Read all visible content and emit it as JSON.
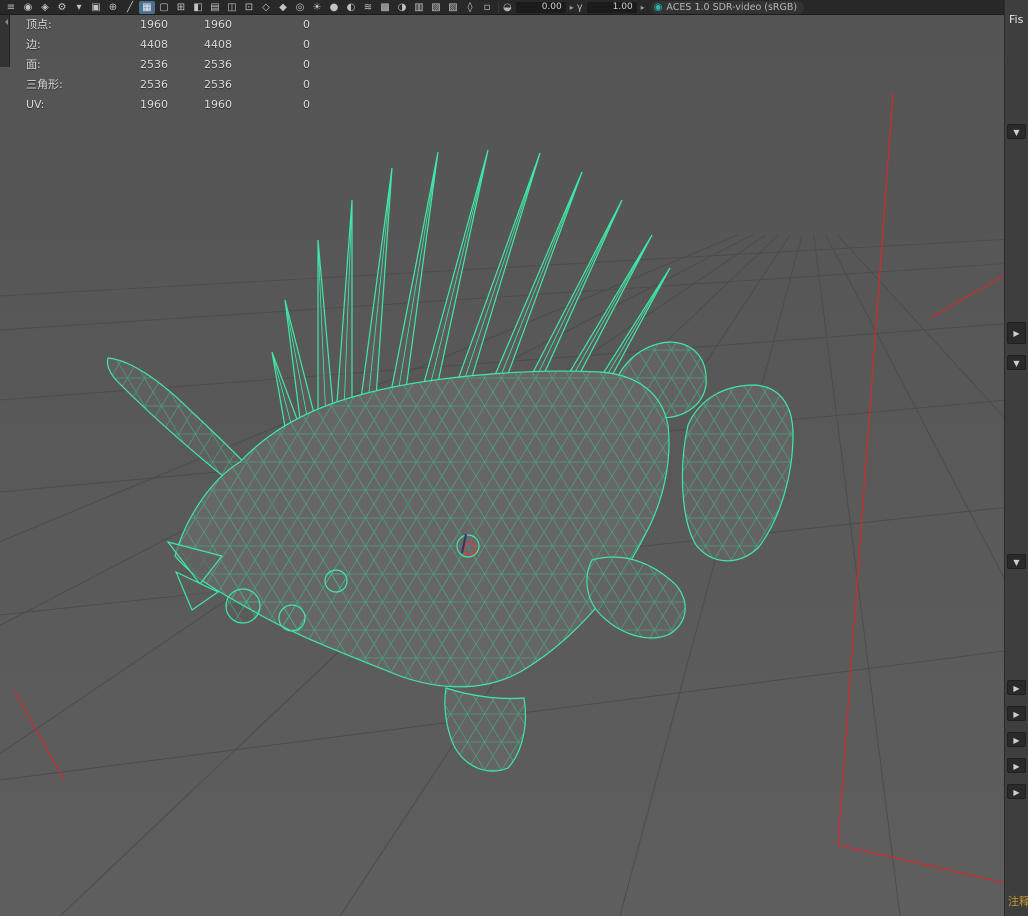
{
  "toolbar": {
    "icons": [
      {
        "name": "menu-icon",
        "glyph": "≡"
      },
      {
        "name": "select-camera-icon",
        "glyph": "◉"
      },
      {
        "name": "lock-camera-icon",
        "glyph": "◈"
      },
      {
        "name": "camera-attributes-icon",
        "glyph": "⚙"
      },
      {
        "name": "bookmarks-icon",
        "glyph": "▾"
      },
      {
        "name": "image-plane-icon",
        "glyph": "▣"
      },
      {
        "name": "pan-zoom-icon",
        "glyph": "⊕"
      },
      {
        "name": "grease-pencil-icon",
        "glyph": "╱"
      },
      {
        "name": "grid-icon",
        "glyph": "▦",
        "active": true
      },
      {
        "name": "film-gate-icon",
        "glyph": "▢"
      },
      {
        "name": "resolution-gate-icon",
        "glyph": "⊞"
      },
      {
        "name": "gate-mask-icon",
        "glyph": "◧"
      },
      {
        "name": "field-chart-icon",
        "glyph": "▤"
      },
      {
        "name": "safe-action-icon",
        "glyph": "◫"
      },
      {
        "name": "safe-title-icon",
        "glyph": "⊡"
      },
      {
        "name": "frame-all-icon",
        "glyph": "◇"
      },
      {
        "name": "frame-selection-icon",
        "glyph": "◆"
      },
      {
        "name": "isolate-select-icon",
        "glyph": "◎"
      },
      {
        "name": "lighting-icon",
        "glyph": "☀"
      },
      {
        "name": "shadows-icon",
        "glyph": "●"
      },
      {
        "name": "ambient-occlusion-icon",
        "glyph": "◐"
      },
      {
        "name": "motion-blur-icon",
        "glyph": "≋"
      },
      {
        "name": "multisampling-icon",
        "glyph": "▩"
      },
      {
        "name": "depth-of-field-icon",
        "glyph": "◑"
      },
      {
        "name": "xray-icon",
        "glyph": "▥"
      },
      {
        "name": "wireframe-on-shaded-icon",
        "glyph": "▧"
      },
      {
        "name": "textured-icon",
        "glyph": "▨"
      },
      {
        "name": "use-default-material-icon",
        "glyph": "◊"
      },
      {
        "name": "plugin-shading-icon",
        "glyph": "▫"
      }
    ],
    "exposure_icon": "◒",
    "exposure_value": "0.00",
    "gamma_icon": "γ",
    "gamma_value": "1.00",
    "caret": "▸",
    "view_transform_icon": "◉",
    "colorspace_label": "ACES 1.0 SDR-video (sRGB)"
  },
  "hud": {
    "rows": [
      {
        "label": "顶点:",
        "c1": "1960",
        "c2": "1960",
        "c3": "0"
      },
      {
        "label": "边:",
        "c1": "4408",
        "c2": "4408",
        "c3": "0"
      },
      {
        "label": "面:",
        "c1": "2536",
        "c2": "2536",
        "c3": "0"
      },
      {
        "label": "三角形:",
        "c1": "2536",
        "c2": "2536",
        "c3": "0"
      },
      {
        "label": "UV:",
        "c1": "1960",
        "c2": "1960",
        "c3": "0"
      }
    ]
  },
  "right_panel": {
    "tab_label": "Fis",
    "note_label": "注释"
  },
  "icons": {
    "collapse": "▼",
    "expand": "▶"
  },
  "colors": {
    "wireframe_green": "#3fe8a6",
    "selection_red": "#cf2b2b",
    "viewport_gray": "#5a5a5a",
    "hud_text": "#dadada",
    "colorspace_teal": "#29b5b2",
    "note_orange": "#c99a2e"
  }
}
